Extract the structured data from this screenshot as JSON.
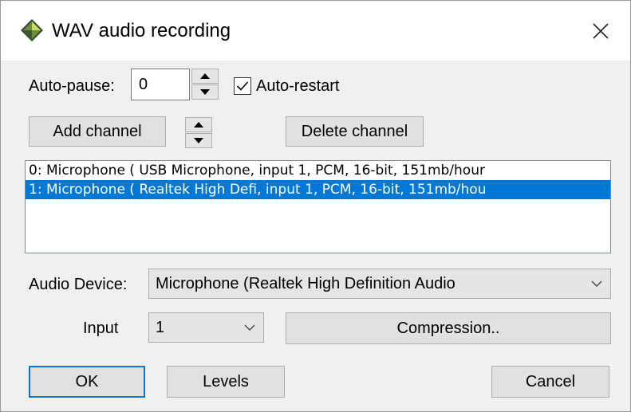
{
  "window": {
    "title": "WAV audio recording"
  },
  "auto_pause": {
    "label": "Auto-pause:",
    "value": "0"
  },
  "auto_restart": {
    "label": "Auto-restart",
    "checked": true
  },
  "channel_buttons": {
    "add_label": "Add channel",
    "delete_label": "Delete channel"
  },
  "channels": [
    {
      "text": "0: Microphone ( USB Microphone, input 1, PCM, 16-bit, 151mb/hour",
      "selected": false
    },
    {
      "text": "1: Microphone ( Realtek High Defi, input 1, PCM, 16-bit, 151mb/hou",
      "selected": true
    }
  ],
  "audio_device": {
    "label": "Audio Device:",
    "value": "Microphone (Realtek High Definition Audio"
  },
  "input": {
    "label": "Input",
    "value": "1"
  },
  "compression_label": "Compression..",
  "footer": {
    "ok_label": "OK",
    "levels_label": "Levels",
    "cancel_label": "Cancel"
  },
  "icons": {
    "app": "app-diamond-icon",
    "close": "close-icon",
    "up": "arrow-up-icon",
    "down": "arrow-down-icon",
    "check": "checkmark-icon",
    "dropdown": "chevron-down-icon"
  },
  "colors": {
    "selection": "#0078d7",
    "dialog_bg": "#f0f0f0",
    "button_bg": "#e1e1e1"
  }
}
